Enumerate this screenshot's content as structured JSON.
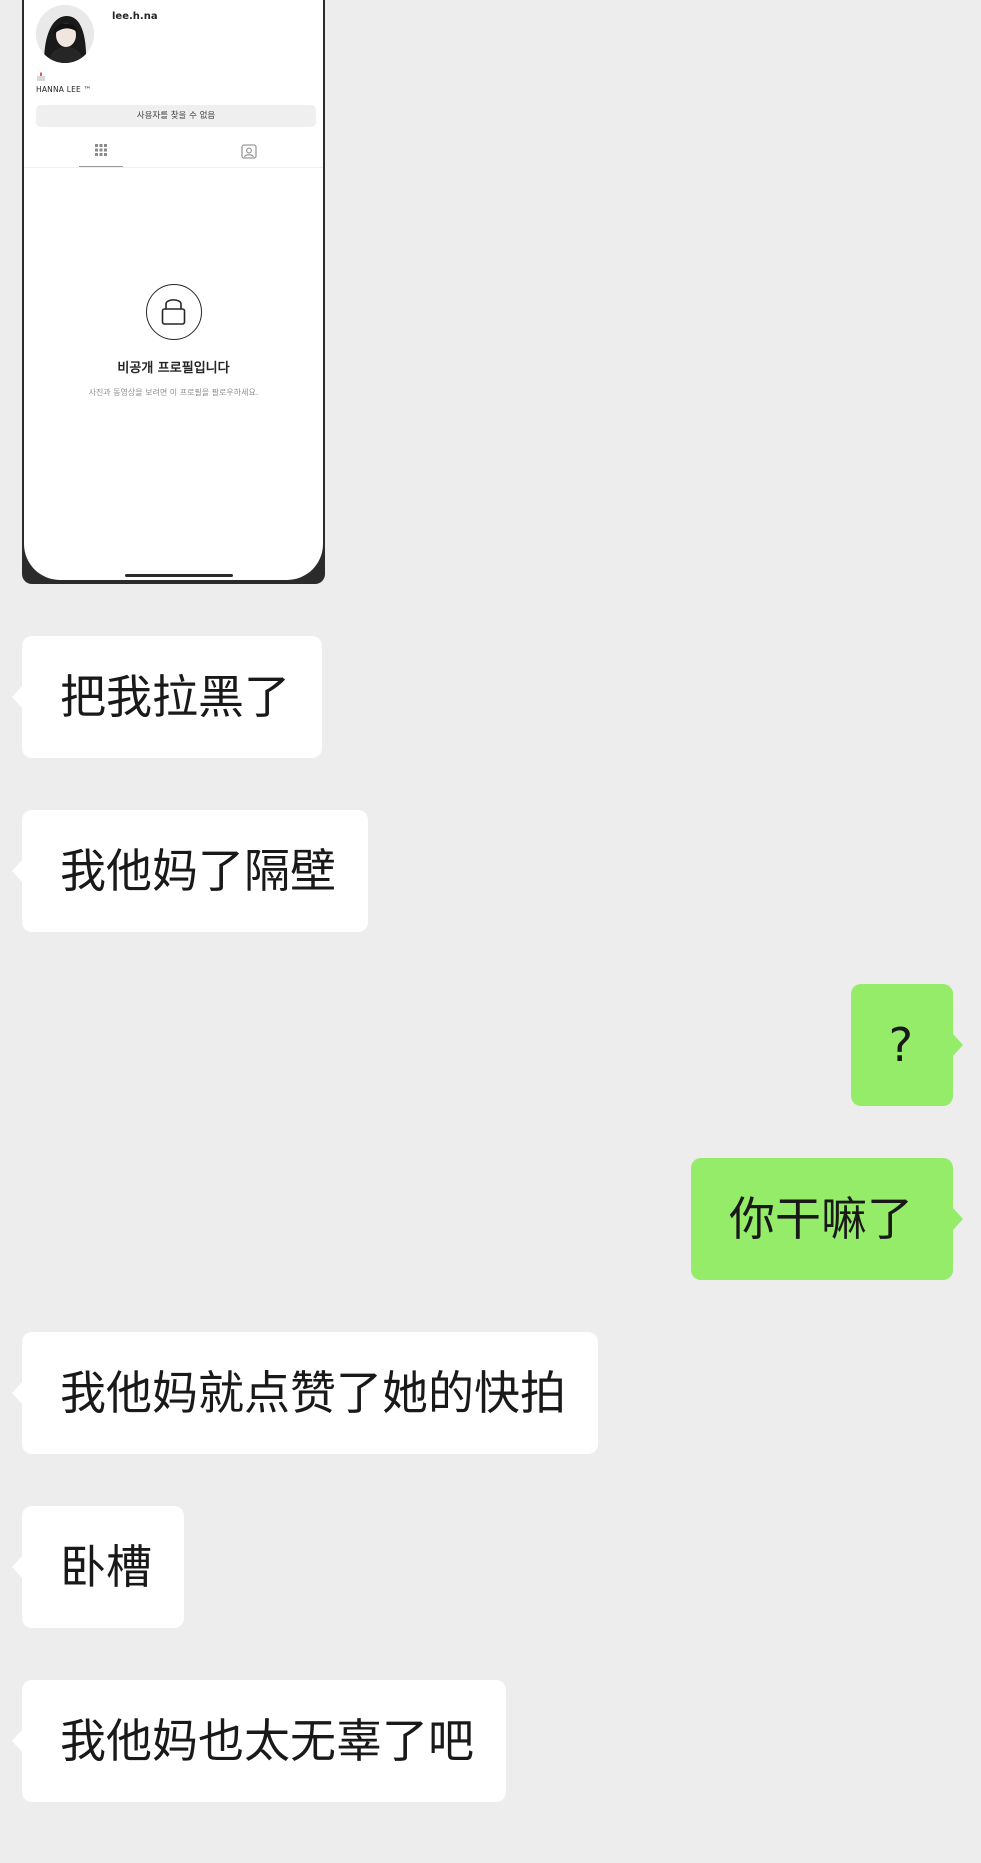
{
  "embedded_screenshot": {
    "username": "lee.h.na",
    "display_name": "HANNA LEE ™",
    "notice": "사용자를 찾을 수 없음",
    "private_title": "비공개 프로필입니다",
    "private_subtitle": "사진과 동영상을 보려면 이 프로필을 팔로우하세요.",
    "tabs": [
      "grid-icon",
      "tagged-icon"
    ],
    "lock_icon": "lock-icon"
  },
  "messages": [
    {
      "side": "left",
      "text": "把我拉黑了"
    },
    {
      "side": "left",
      "text": "我他妈了隔壁"
    },
    {
      "side": "right",
      "text": "?"
    },
    {
      "side": "right",
      "text": "你干嘛了"
    },
    {
      "side": "left",
      "text": "我他妈就点赞了她的快拍"
    },
    {
      "side": "left",
      "text": "卧槽"
    },
    {
      "side": "left",
      "text": "我他妈也太无辜了吧"
    }
  ],
  "colors": {
    "background": "#ededed",
    "incoming_bubble": "#ffffff",
    "outgoing_bubble": "#95ec69",
    "text": "#191919"
  }
}
